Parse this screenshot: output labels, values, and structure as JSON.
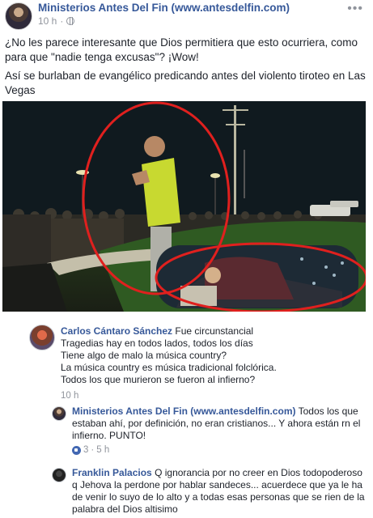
{
  "post": {
    "page_name": "Ministerios Antes Del Fin (www.antesdelfin.com)",
    "time": "10 h",
    "time_separator": "·",
    "text_1": "¿No les parece interesante que Dios permitiera que esto ocurriera, como para que \"nadie tenga excusas\"? ¡Wow!",
    "text_2": "Así se burlaban de evangélico predicando antes del violento tiroteo en Las Vegas",
    "more_icon": "more-options-icon"
  },
  "comments": [
    {
      "name": "Carlos Cántaro Sánchez",
      "lines": [
        "Fue circunstancial",
        "Tragedias hay en todos lados, todos los días",
        "Tiene algo de malo la música country?",
        "La música country es música tradicional folclórica.",
        "Todos los que murieron se fueron al infierno?"
      ],
      "time": "10 h"
    },
    {
      "name": "Ministerios Antes Del Fin (www.antesdelfin.com)",
      "text": "Todos los que estaban ahí, por definición, no eran cristianos... Y ahora están rn el infierno. PUNTO!",
      "likes": "3",
      "time": "5 h",
      "separator": "·"
    },
    {
      "name": "Franklin Palacios",
      "text": "Q ignorancia por no creer en Dios todopoderoso q Jehova la perdone por hablar sandeces... acuerdece que ya le ha de venir lo suyo de lo alto y a todas esas personas que se rien de la palabra del Dios altisimo"
    }
  ],
  "colors": {
    "link": "#365899",
    "meta": "#90949c",
    "text": "#1d2129",
    "highlight_circle": "#e0201e"
  }
}
